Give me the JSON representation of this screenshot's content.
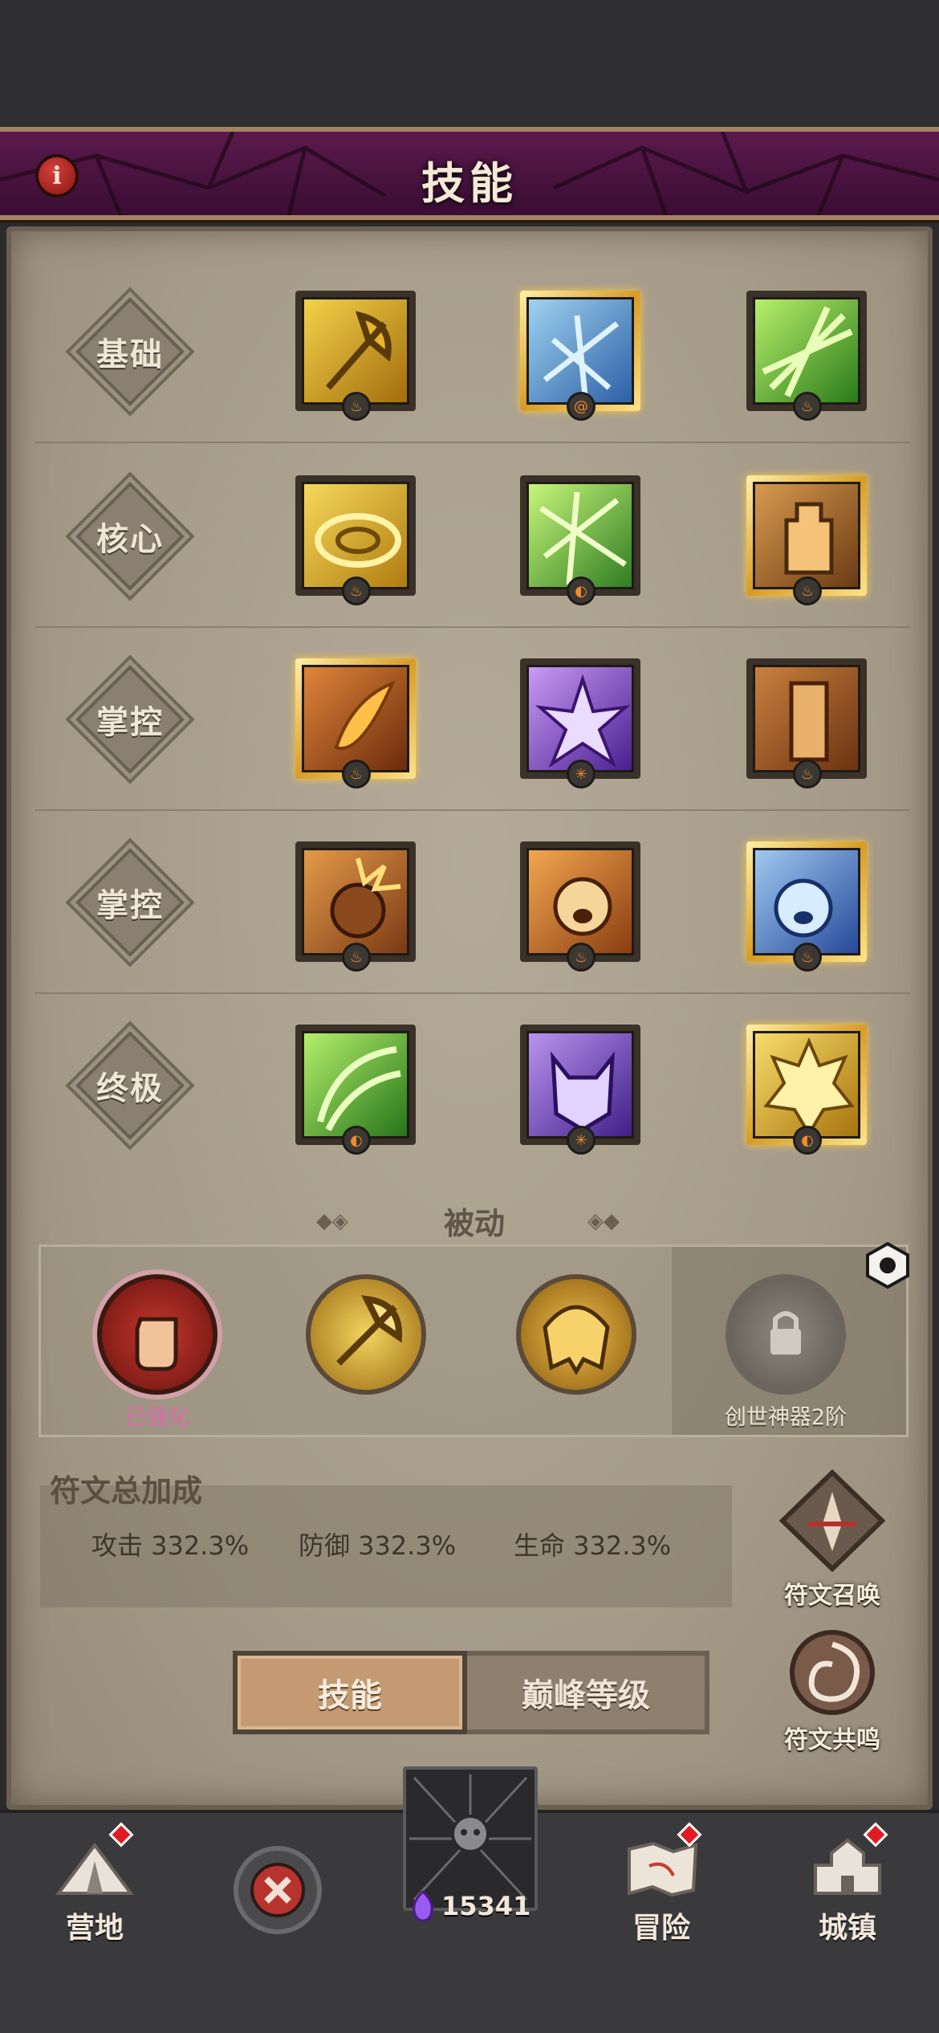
{
  "header": {
    "title": "技能"
  },
  "rows": [
    {
      "label": "基础"
    },
    {
      "label": "核心"
    },
    {
      "label": "掌控"
    },
    {
      "label": "掌控"
    },
    {
      "label": "终极"
    }
  ],
  "passive": {
    "title": "被动",
    "orbs": [
      {
        "label": "已强化",
        "icon": "fist-icon"
      },
      {
        "icon": "axe-icon"
      },
      {
        "icon": "helmet-icon"
      },
      {
        "label": "创世神器2阶",
        "icon": "lock-icon"
      }
    ]
  },
  "rune_bonus": {
    "title": "符文总加成",
    "stats": [
      {
        "text": "攻击 332.3%"
      },
      {
        "text": "防御 332.3%"
      },
      {
        "text": "生命 332.3%"
      }
    ]
  },
  "side_buttons": {
    "summon": "符文召唤",
    "resonance": "符文共鸣"
  },
  "tabs": {
    "skills": "技能",
    "peak_level": "巅峰等级"
  },
  "nav": {
    "camp": "营地",
    "adventure": "冒险",
    "town": "城镇",
    "currency": "15341"
  },
  "colors": {
    "header_purple": "#5b1a4e",
    "parchment": "#a69b89",
    "gold_highlight": "#f5c94a",
    "red_dot": "#e11b23"
  }
}
